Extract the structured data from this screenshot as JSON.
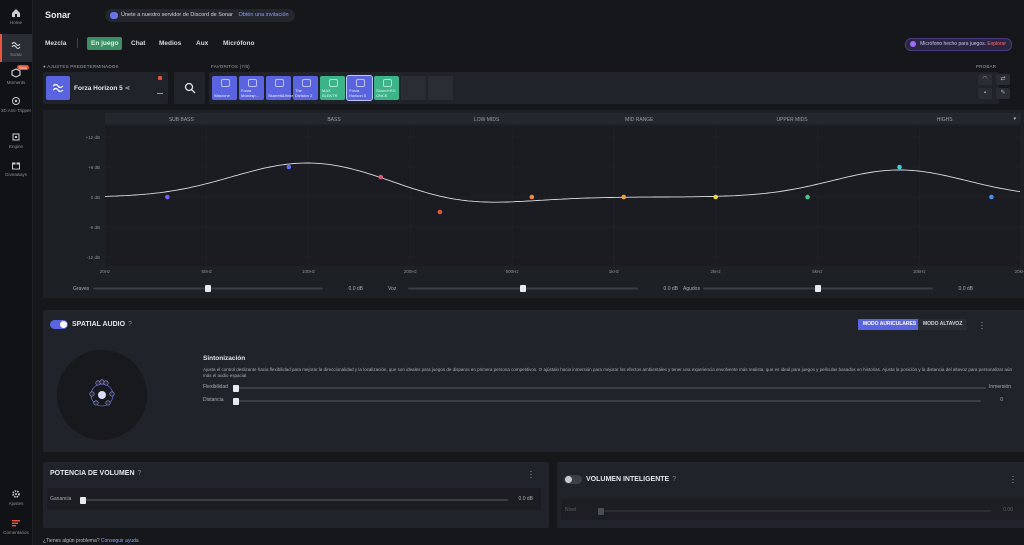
{
  "sidebar": {
    "items": [
      {
        "label": "Home",
        "icon": "home-icon"
      },
      {
        "label": "Sonar",
        "icon": "sonar-icon",
        "active": true
      },
      {
        "label": "Moments",
        "icon": "moments-icon",
        "badge": "New"
      },
      {
        "label": "3D Anti-Tripper",
        "icon": "hex-icon"
      },
      {
        "label": "Engine",
        "icon": "engine-icon"
      },
      {
        "label": "Giveaways",
        "icon": "gift-icon"
      },
      {
        "label": "Ajustes",
        "icon": "gear-icon"
      },
      {
        "label": "Comentarios",
        "icon": "feedback-icon"
      }
    ]
  },
  "header": {
    "title": "Sonar",
    "discord_text": "Únete a nuestro servidor de Discord de Sonar",
    "discord_link": "Obtén una invitación"
  },
  "tabs": [
    {
      "label": "Mezcla"
    },
    {
      "label": "En juego",
      "active": true
    },
    {
      "label": "Chat"
    },
    {
      "label": "Medios"
    },
    {
      "label": "Aux"
    },
    {
      "label": "Micrófono"
    }
  ],
  "mic_banner": {
    "text": "Micrófono hecho para juegos.",
    "link": "Explorar"
  },
  "presets": {
    "label": "AJUSTES PREDETERMINADOS",
    "current": "Forza Horizon 5",
    "favorites_label": "FAVORITOS (7/8)",
    "favorites": [
      {
        "name": "Warzone",
        "color": "blue"
      },
      {
        "name": "Forza Motorsp...",
        "color": "blue"
      },
      {
        "name": "Skarrett&Ihmes",
        "color": "blue"
      },
      {
        "name": "The Division 2",
        "color": "blue"
      },
      {
        "name": "MAX SLEKTR",
        "color": "green"
      },
      {
        "name": "Forza Horizon 5",
        "color": "blue",
        "selected": true
      },
      {
        "name": "Sound+ED ONCE",
        "color": "green"
      },
      {
        "name": "",
        "color": "empty"
      },
      {
        "name": "",
        "color": "empty"
      }
    ],
    "probar_label": "PROBAR"
  },
  "eq": {
    "bands": [
      "SUB BASS",
      "BASS",
      "LOW MIDS",
      "MID RANGE",
      "UPPER MIDS",
      "HIGHS"
    ],
    "db_ticks": [
      "+12 dB",
      "+6 dB",
      "0 dB",
      "-6 dB",
      "-12 dB"
    ],
    "freq_ticks": [
      "20Hz",
      "50Hz",
      "100Hz",
      "200Hz",
      "500Hz",
      "1kHz",
      "2kHz",
      "5kHz",
      "10kHz",
      "20kHz"
    ],
    "points": [
      {
        "freq_hz": 32,
        "gain_db": 0,
        "color": "#7a5cff"
      },
      {
        "freq_hz": 80,
        "gain_db": 6,
        "color": "#5b6cff"
      },
      {
        "freq_hz": 160,
        "gain_db": 4,
        "color": "#e0567a"
      },
      {
        "freq_hz": 250,
        "gain_db": -3,
        "color": "#e8553b"
      },
      {
        "freq_hz": 500,
        "gain_db": 0,
        "color": "#f08a3a"
      },
      {
        "freq_hz": 1000,
        "gain_db": 0,
        "color": "#f0a03a"
      },
      {
        "freq_hz": 2000,
        "gain_db": 0,
        "color": "#e8d840"
      },
      {
        "freq_hz": 4000,
        "gain_db": 0,
        "color": "#3bc98a"
      },
      {
        "freq_hz": 8000,
        "gain_db": 6,
        "color": "#3ccbd8"
      },
      {
        "freq_hz": 16000,
        "gain_db": 0,
        "color": "#3a8ff0"
      }
    ],
    "sliders": [
      {
        "label": "Graves",
        "value": "0.0 dB",
        "level": 0.5
      },
      {
        "label": "Voz",
        "value": "0.0 dB",
        "level": 0.5
      },
      {
        "label": "Agudos",
        "value": "0.0 dB",
        "level": 0.5
      }
    ]
  },
  "spatial": {
    "title": "SPATIAL AUDIO",
    "mode_on": "MODO AURICULARES",
    "mode_off": "MODO ALTAVOZ",
    "sintonizacion_title": "Sintonización",
    "description": "Ajusta el control deslizante hacia flexibilidad para mejorar la direccionalidad y la localización, que son ideales para juegos de disparos en primera persona competitivos. O ajústalo hacia inmersión para mejorar los efectos ambientales y tener una experiencia envolvente más realista, que es ideal para juegos y películas basados en historias. Ajusta la posición y la distancia del altavoz para personalizar aún más el audio espacial.",
    "flex_label": "Flexibilidad",
    "flex_right": "Inmersión",
    "flex_level": 0,
    "dist_label": "Distancia",
    "dist_value": "0",
    "dist_level": 0
  },
  "potencia": {
    "title": "POTENCIA DE VOLUMEN",
    "slider_label": "Ganancia",
    "slider_value": "0.0 dB",
    "level": 0
  },
  "volumen_inteligente": {
    "title": "VOLUMEN INTELIGENTE",
    "slider_label": "Nivel",
    "slider_value": "0.00",
    "level": 0
  },
  "footer": {
    "text": "¿Tienes algún problema?",
    "link": "Conseguir ayuda"
  }
}
